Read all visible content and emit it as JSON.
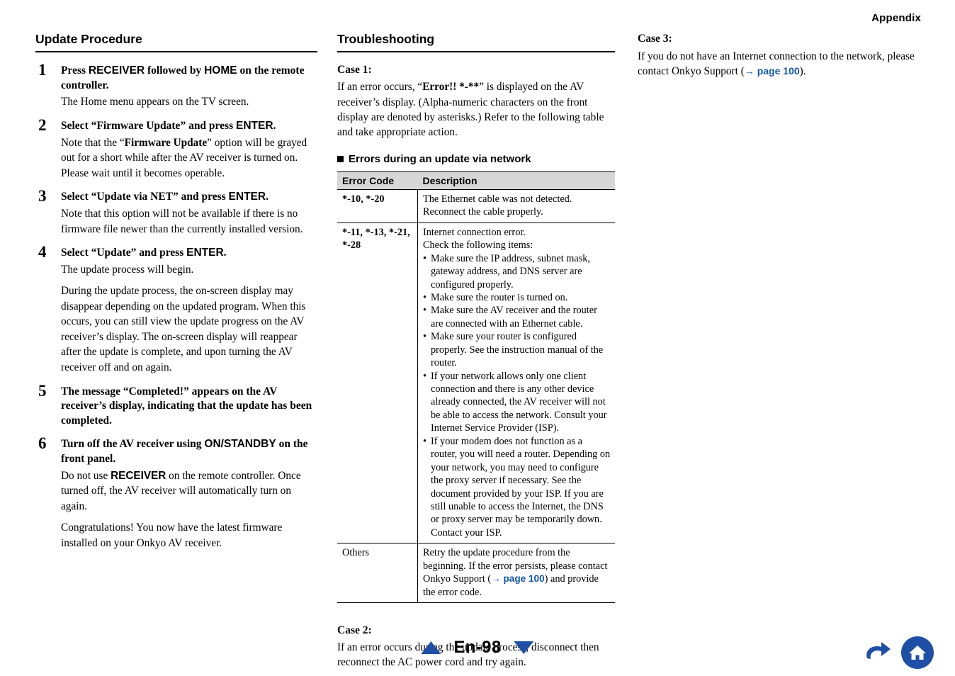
{
  "header": {
    "appendix": "Appendix"
  },
  "col1": {
    "title": "Update Procedure",
    "steps": [
      {
        "num": "1",
        "head_parts": [
          {
            "t": "Press ",
            "s": "serif"
          },
          {
            "t": "RECEIVER",
            "s": "sans"
          },
          {
            "t": " followed by ",
            "s": "serif"
          },
          {
            "t": "HOME",
            "s": "sans"
          },
          {
            "t": " on the remote controller.",
            "s": "serif"
          }
        ],
        "body": [
          "The Home menu appears on the TV screen."
        ]
      },
      {
        "num": "2",
        "head_parts": [
          {
            "t": "Select “Firmware Update” and press ",
            "s": "serif"
          },
          {
            "t": "ENTER",
            "s": "sans"
          },
          {
            "t": ".",
            "s": "serif"
          }
        ],
        "body": [
          "Note that the “Firmware Update” option will be grayed out for a short while after the AV receiver is turned on. Please wait until it becomes operable."
        ]
      },
      {
        "num": "3",
        "head_parts": [
          {
            "t": "Select “Update via NET” and press ",
            "s": "serif"
          },
          {
            "t": "ENTER",
            "s": "sans"
          },
          {
            "t": ".",
            "s": "serif"
          }
        ],
        "body": [
          "Note that this option will not be available if there is no firmware file newer than the currently installed version."
        ]
      },
      {
        "num": "4",
        "head_parts": [
          {
            "t": "Select “Update” and press ",
            "s": "serif"
          },
          {
            "t": "ENTER",
            "s": "sans"
          },
          {
            "t": ".",
            "s": "serif"
          }
        ],
        "body": [
          "The update process will begin.",
          "During the update process, the on-screen display may disappear depending on the updated program. When this occurs, you can still view the update progress on the AV receiver’s display. The on-screen display will reappear after the update is complete, and upon turning the AV receiver off and on again."
        ]
      },
      {
        "num": "5",
        "head_parts": [
          {
            "t": "The message “Completed!” appears on the AV receiver’s display, indicating that the update has been completed.",
            "s": "serif"
          }
        ],
        "body": []
      },
      {
        "num": "6",
        "head_parts": [
          {
            "t": "Turn off the AV receiver using ",
            "s": "serif"
          },
          {
            "t": " ON/STANDBY",
            "s": "sans"
          },
          {
            "t": " on the front panel.",
            "s": "serif"
          }
        ],
        "body": [
          "Do not use  RECEIVER on the remote controller. Once turned off, the AV receiver will automatically turn on again.",
          "Congratulations! You now have the latest firmware installed on your Onkyo AV receiver."
        ]
      }
    ],
    "step6_body1_pre": "Do not use ",
    "step6_body1_sans": " RECEIVER",
    "step6_body1_post": " on the remote controller. Once turned off, the AV receiver will automatically turn on again."
  },
  "col2": {
    "title": "Troubleshooting",
    "case1_title": "Case 1:",
    "case1_pre": "If an error occurs, “",
    "case1_bold": "Error!! *-**",
    "case1_post": "” is displayed on the AV receiver’s display. (Alpha-numeric characters on the front display are denoted by asterisks.) Refer to the following table and take appropriate action.",
    "subhead": "Errors during an update via network",
    "table": {
      "headers": [
        "Error Code",
        "Description"
      ],
      "rows": [
        {
          "code": "*-10, *-20",
          "code_bold": true,
          "desc_lines": [
            "The Ethernet cable was not detected.",
            "Reconnect the cable properly."
          ],
          "bullets": []
        },
        {
          "code": "*-11, *-13, *-21, *-28",
          "code_bold": true,
          "desc_lines": [
            "Internet connection error.",
            "Check the following items:"
          ],
          "bullets": [
            "Make sure the IP address, subnet mask, gateway address, and DNS server are configured properly.",
            "Make sure the router is turned on.",
            "Make sure the AV receiver and the router are connected with an Ethernet cable.",
            "Make sure your router is configured properly. See the instruction manual of the router.",
            "If your network allows only one client connection and there is any other device already connected, the AV receiver will not be able to access the network. Consult your Internet Service Provider (ISP).",
            "If your modem does not function as a router, you will need a router. Depending on your network, you may need to configure the proxy server if necessary. See the document provided by your ISP. If you are still unable to access the Internet, the DNS or proxy server may be temporarily down. Contact your ISP."
          ]
        },
        {
          "code": "Others",
          "code_bold": false,
          "desc_lines": [],
          "bullets": [],
          "desc_rich": {
            "pre": "Retry the update procedure from the beginning. If the error persists, please contact Onkyo Support (",
            "link": "→ page 100",
            "post": ") and provide the error code."
          }
        }
      ]
    },
    "case2_title": "Case 2:",
    "case2_body": "If an error occurs during the update process, disconnect then reconnect the AC power cord and try again."
  },
  "col3": {
    "case3_title": "Case 3:",
    "case3_pre": "If you do not have an Internet connection to the network, please contact Onkyo Support (",
    "case3_link": "→ page 100",
    "case3_post": ")."
  },
  "footer": {
    "page_label": "En-98",
    "up_icon": "triangle-up-icon",
    "down_icon": "triangle-down-icon",
    "back_icon": "back-arrow-icon",
    "home_icon": "home-icon",
    "accent": "#1f4fa5",
    "link_color": "#1457a8"
  }
}
